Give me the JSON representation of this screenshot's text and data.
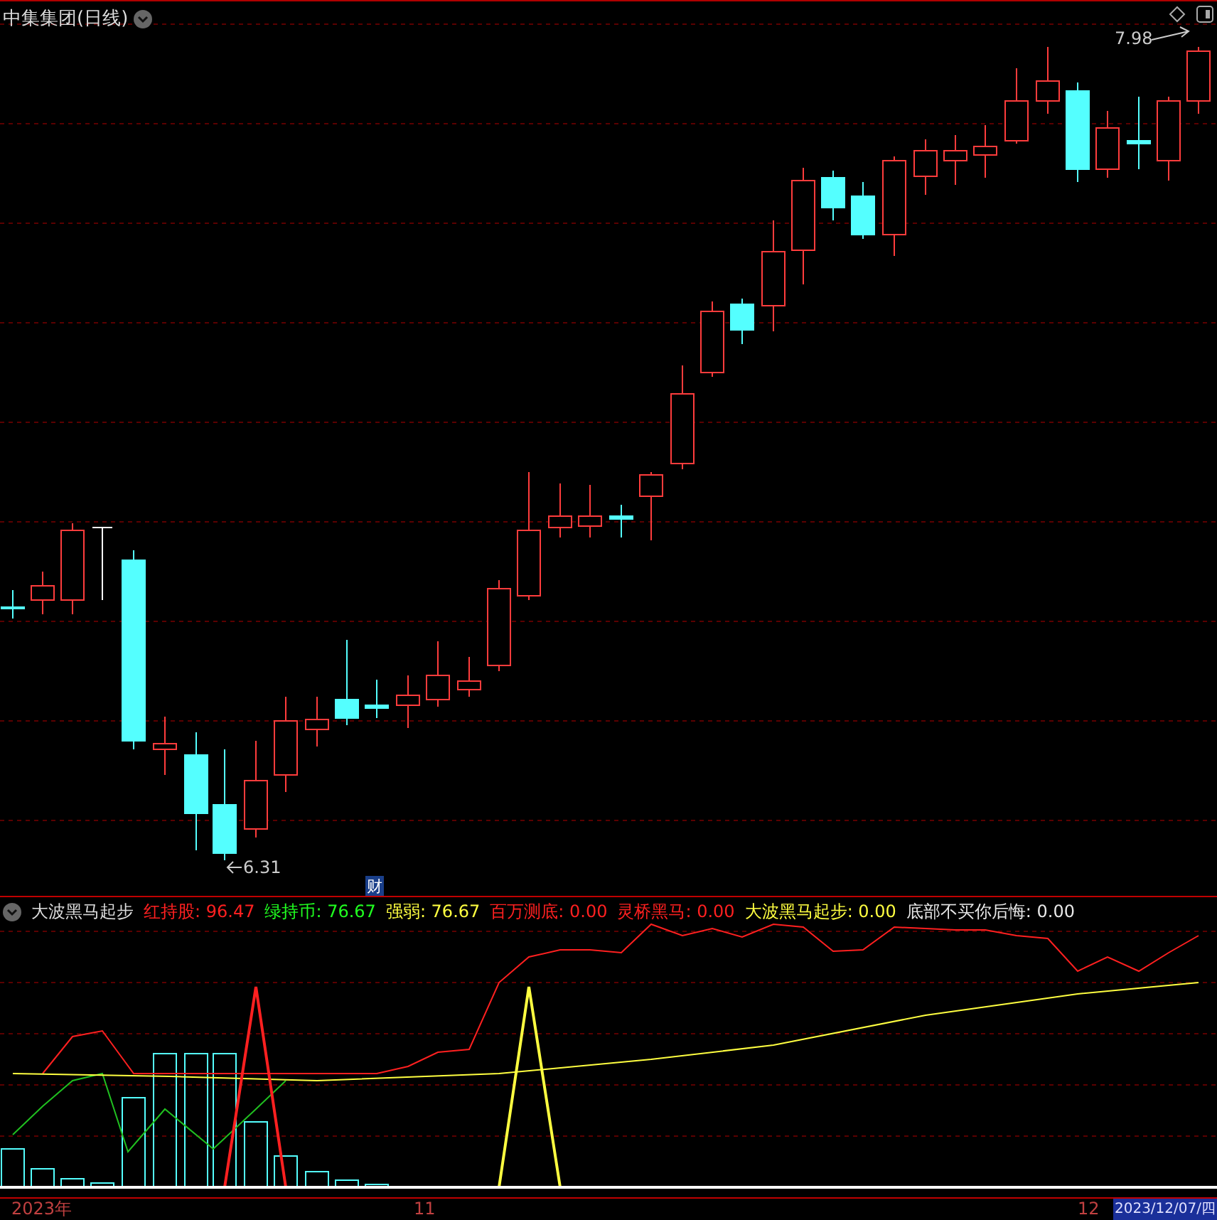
{
  "price_panel": {
    "title": "中集集团(日线)",
    "high_label": "7.98",
    "low_label": "6.31",
    "badge": "财"
  },
  "indicator_panel": {
    "name": "大波黑马起步",
    "values": [
      {
        "text": "红持股: 96.47",
        "color": "#ff2020"
      },
      {
        "text": "绿持币: 76.67",
        "color": "#20ff20"
      },
      {
        "text": "强弱: 76.67",
        "color": "#ffff40"
      },
      {
        "text": "百万测底: 0.00",
        "color": "#ff2020"
      },
      {
        "text": "灵桥黑马: 0.00",
        "color": "#ff2020"
      },
      {
        "text": "大波黑马起步: 0.00",
        "color": "#ffff40"
      },
      {
        "text": "底部不买你后悔: 0.00",
        "color": "#e8e8e8"
      }
    ]
  },
  "time_axis": {
    "labels": [
      "2023年",
      "11",
      "12"
    ],
    "cursor_date": "2023/12/07/四"
  }
}
